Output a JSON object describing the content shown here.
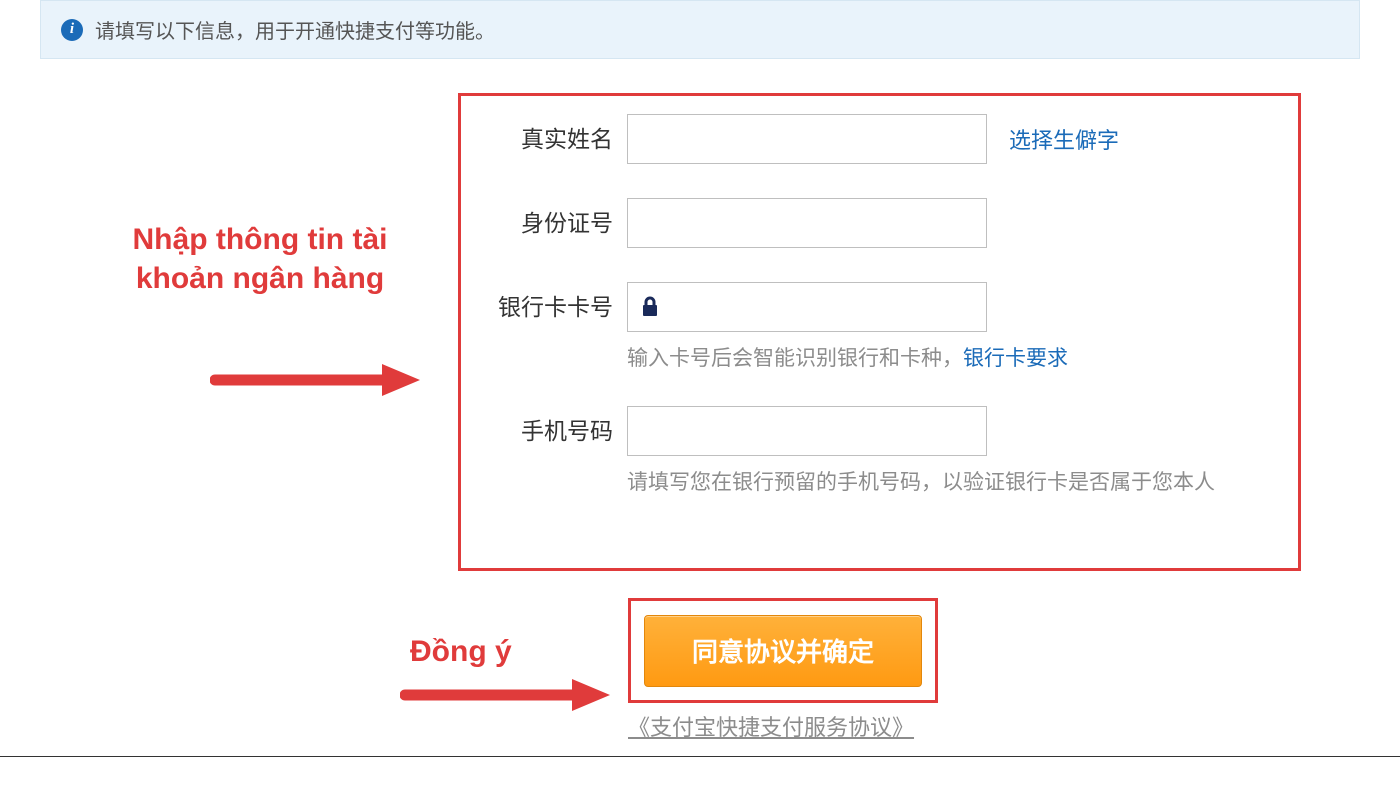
{
  "banner": {
    "text": "请填写以下信息，用于开通快捷支付等功能。"
  },
  "form": {
    "realname_label": "真实姓名",
    "rare_char_link": "选择生僻字",
    "id_label": "身份证号",
    "bankcard_label": "银行卡卡号",
    "bankcard_hint_prefix": "输入卡号后会智能识别银行和卡种，",
    "bankcard_hint_link": "银行卡要求",
    "phone_label": "手机号码",
    "phone_hint": "请填写您在银行预留的手机号码，以验证银行卡是否属于您本人"
  },
  "submit": {
    "button_label": "同意协议并确定",
    "agreement_link": "《支付宝快捷支付服务协议》"
  },
  "annotations": {
    "bank_info": "Nhập thông tin tài khoản ngân hàng",
    "agree": "Đồng ý"
  },
  "colors": {
    "highlight": "#e03b3b",
    "link": "#1b6bb8",
    "button_bg": "#ff9a12"
  }
}
